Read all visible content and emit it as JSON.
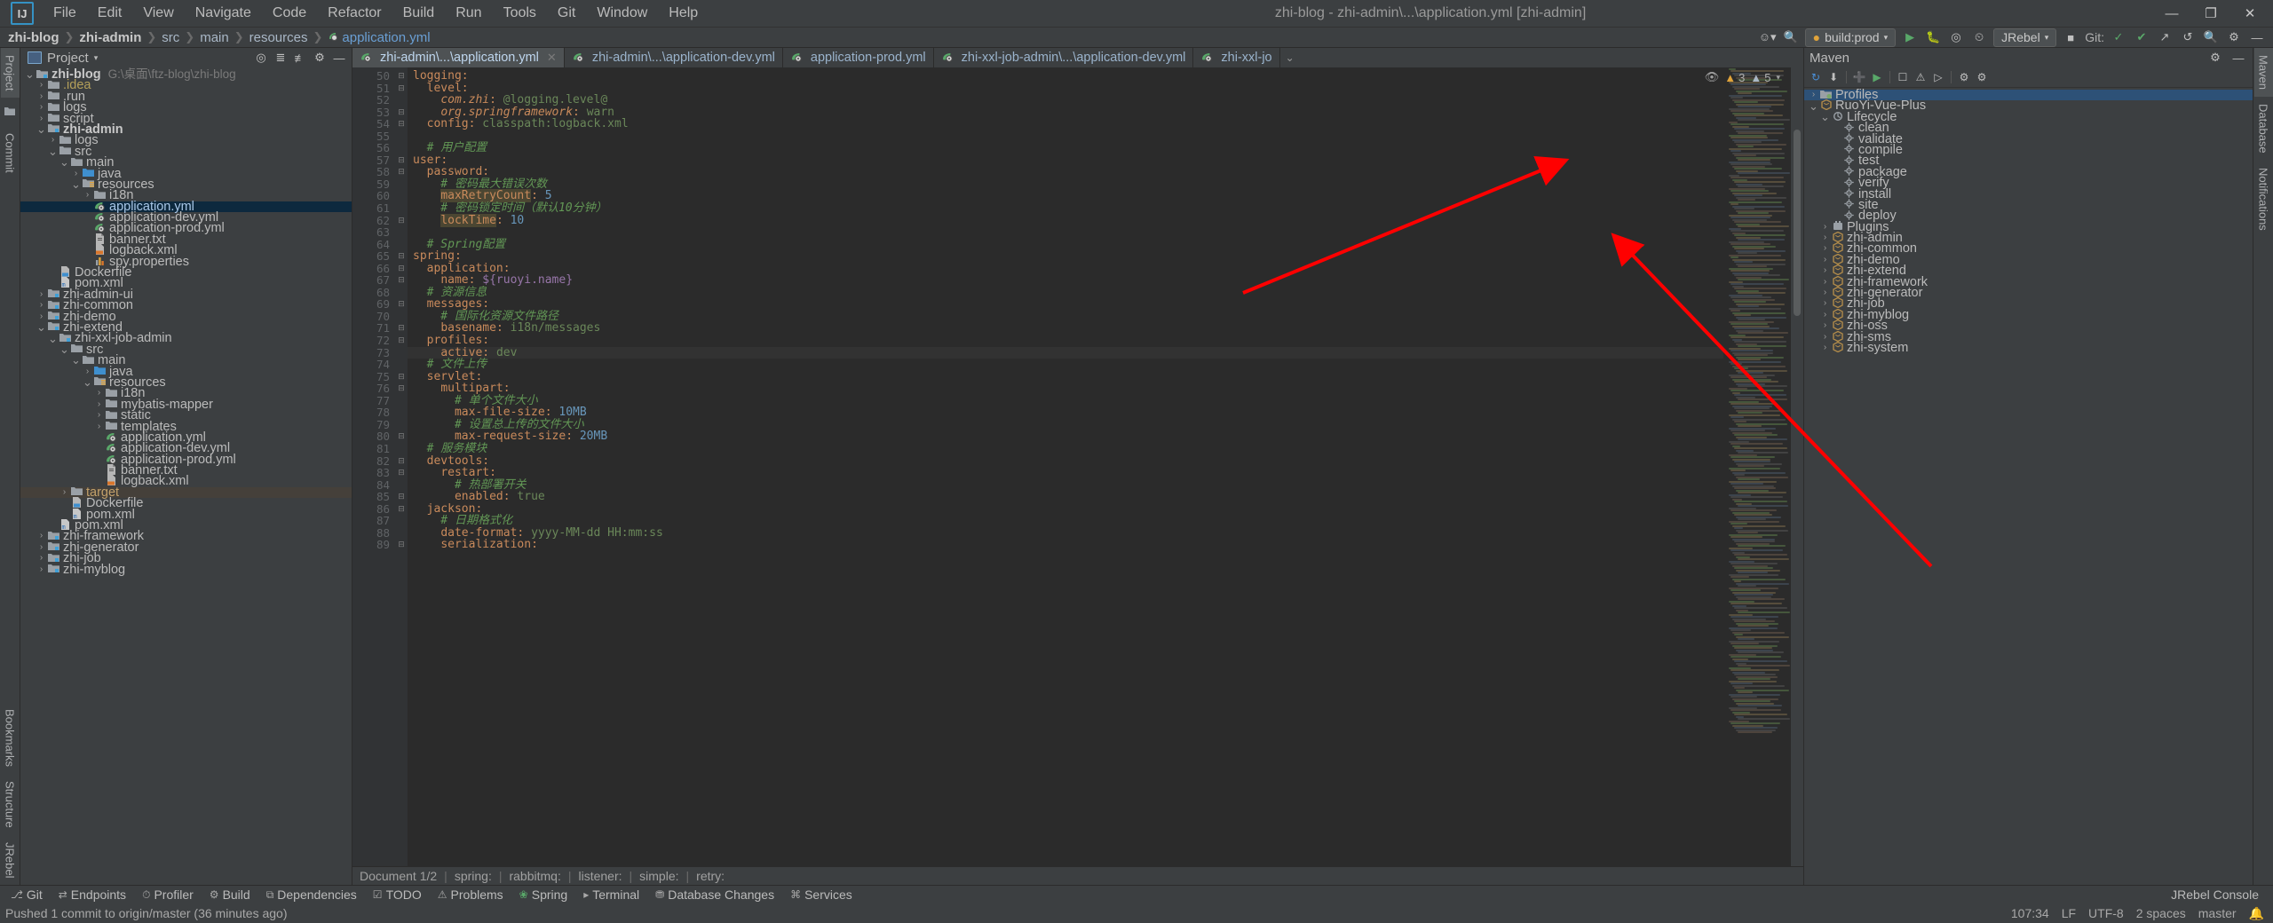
{
  "window": {
    "title": "zhi-blog - zhi-admin\\...\\application.yml [zhi-admin]",
    "logo": "IJ",
    "minimize": "—",
    "maximize": "❐",
    "close": "✕"
  },
  "menu": [
    "File",
    "Edit",
    "View",
    "Navigate",
    "Code",
    "Refactor",
    "Build",
    "Run",
    "Tools",
    "Git",
    "Window",
    "Help"
  ],
  "navbar": {
    "crumbs": [
      {
        "label": "zhi-blog",
        "bold": true
      },
      {
        "label": "zhi-admin",
        "bold": true
      },
      {
        "label": "src",
        "bold": false
      },
      {
        "label": "main",
        "bold": false
      },
      {
        "label": "resources",
        "bold": false
      },
      {
        "label": "application.yml",
        "bold": false,
        "icon": "yml-icon"
      }
    ],
    "run_config": "build:prod",
    "jrebel": "JRebel",
    "git_label": "Git:",
    "icons": [
      "user-icon",
      "search-everywhere-icon",
      "run-icon",
      "debug-icon",
      "coverage-icon",
      "profile-icon",
      "stop-icon",
      "settings-icon",
      "search-icon",
      "minimize-icon"
    ]
  },
  "left_stripe": [
    "Project",
    "Commit"
  ],
  "left_stripe_bottom": [
    "Bookmarks",
    "Structure",
    "JRebel"
  ],
  "right_stripe": [
    "Maven",
    "Database",
    "Notifications"
  ],
  "project_panel": {
    "title": "Project",
    "tree": [
      {
        "depth": 0,
        "arrow": "v",
        "icon": "module-icon",
        "label": "zhi-blog",
        "bold": true,
        "sub": "G:\\桌面\\ftz-blog\\zhi-blog"
      },
      {
        "depth": 1,
        "arrow": ">",
        "icon": "folder-icon",
        "label": ".idea",
        "yellow": true
      },
      {
        "depth": 1,
        "arrow": ">",
        "icon": "folder-icon",
        "label": ".run"
      },
      {
        "depth": 1,
        "arrow": ">",
        "icon": "folder-icon",
        "label": "logs"
      },
      {
        "depth": 1,
        "arrow": ">",
        "icon": "folder-icon",
        "label": "script"
      },
      {
        "depth": 1,
        "arrow": "v",
        "icon": "module-icon",
        "label": "zhi-admin",
        "bold": true
      },
      {
        "depth": 2,
        "arrow": ">",
        "icon": "folder-icon",
        "label": "logs"
      },
      {
        "depth": 2,
        "arrow": "v",
        "icon": "folder-icon",
        "label": "src"
      },
      {
        "depth": 3,
        "arrow": "v",
        "icon": "folder-icon",
        "label": "main"
      },
      {
        "depth": 4,
        "arrow": ">",
        "icon": "source-folder-icon",
        "label": "java"
      },
      {
        "depth": 4,
        "arrow": "v",
        "icon": "resource-folder-icon",
        "label": "resources"
      },
      {
        "depth": 5,
        "arrow": ">",
        "icon": "folder-icon",
        "label": "i18n"
      },
      {
        "depth": 5,
        "arrow": "",
        "icon": "yml-icon",
        "label": "application.yml",
        "selected": true
      },
      {
        "depth": 5,
        "arrow": "",
        "icon": "yml-icon",
        "label": "application-dev.yml"
      },
      {
        "depth": 5,
        "arrow": "",
        "icon": "yml-icon",
        "label": "application-prod.yml"
      },
      {
        "depth": 5,
        "arrow": "",
        "icon": "text-file-icon",
        "label": "banner.txt"
      },
      {
        "depth": 5,
        "arrow": "",
        "icon": "xml-file-icon",
        "label": "logback.xml"
      },
      {
        "depth": 5,
        "arrow": "",
        "icon": "properties-file-icon",
        "label": "spy.properties"
      },
      {
        "depth": 2,
        "arrow": "",
        "icon": "docker-icon",
        "label": "Dockerfile"
      },
      {
        "depth": 2,
        "arrow": "",
        "icon": "maven-icon",
        "label": "pom.xml"
      },
      {
        "depth": 1,
        "arrow": ">",
        "icon": "module-icon",
        "label": "zhi-admin-ui"
      },
      {
        "depth": 1,
        "arrow": ">",
        "icon": "module-icon",
        "label": "zhi-common"
      },
      {
        "depth": 1,
        "arrow": ">",
        "icon": "module-icon",
        "label": "zhi-demo"
      },
      {
        "depth": 1,
        "arrow": "v",
        "icon": "module-icon",
        "label": "zhi-extend"
      },
      {
        "depth": 2,
        "arrow": "v",
        "icon": "module-icon",
        "label": "zhi-xxl-job-admin"
      },
      {
        "depth": 3,
        "arrow": "v",
        "icon": "folder-icon",
        "label": "src"
      },
      {
        "depth": 4,
        "arrow": "v",
        "icon": "folder-icon",
        "label": "main"
      },
      {
        "depth": 5,
        "arrow": ">",
        "icon": "source-folder-icon",
        "label": "java"
      },
      {
        "depth": 5,
        "arrow": "v",
        "icon": "resource-folder-icon",
        "label": "resources"
      },
      {
        "depth": 6,
        "arrow": ">",
        "icon": "folder-icon",
        "label": "i18n"
      },
      {
        "depth": 6,
        "arrow": ">",
        "icon": "folder-icon",
        "label": "mybatis-mapper"
      },
      {
        "depth": 6,
        "arrow": ">",
        "icon": "folder-icon",
        "label": "static"
      },
      {
        "depth": 6,
        "arrow": ">",
        "icon": "folder-icon",
        "label": "templates"
      },
      {
        "depth": 6,
        "arrow": "",
        "icon": "yml-icon",
        "label": "application.yml"
      },
      {
        "depth": 6,
        "arrow": "",
        "icon": "yml-icon",
        "label": "application-dev.yml"
      },
      {
        "depth": 6,
        "arrow": "",
        "icon": "yml-icon",
        "label": "application-prod.yml"
      },
      {
        "depth": 6,
        "arrow": "",
        "icon": "text-file-icon",
        "label": "banner.txt"
      },
      {
        "depth": 6,
        "arrow": "",
        "icon": "xml-file-icon",
        "label": "logback.xml"
      },
      {
        "depth": 3,
        "arrow": ">",
        "icon": "folder-icon",
        "label": "target",
        "target": true
      },
      {
        "depth": 3,
        "arrow": "",
        "icon": "docker-icon",
        "label": "Dockerfile"
      },
      {
        "depth": 3,
        "arrow": "",
        "icon": "maven-icon",
        "label": "pom.xml"
      },
      {
        "depth": 2,
        "arrow": "",
        "icon": "maven-icon",
        "label": "pom.xml"
      },
      {
        "depth": 1,
        "arrow": ">",
        "icon": "module-icon",
        "label": "zhi-framework"
      },
      {
        "depth": 1,
        "arrow": ">",
        "icon": "module-icon",
        "label": "zhi-generator"
      },
      {
        "depth": 1,
        "arrow": ">",
        "icon": "module-icon",
        "label": "zhi-job"
      },
      {
        "depth": 1,
        "arrow": ">",
        "icon": "module-icon",
        "label": "zhi-myblog"
      }
    ]
  },
  "editor": {
    "tabs": [
      {
        "label": "zhi-admin\\...\\application.yml",
        "active": true,
        "closable": true
      },
      {
        "label": "zhi-admin\\...\\application-dev.yml",
        "active": false
      },
      {
        "label": "application-prod.yml",
        "active": false
      },
      {
        "label": "zhi-xxl-job-admin\\...\\application-dev.yml",
        "active": false
      },
      {
        "label": "zhi-xxl-jo",
        "active": false
      }
    ],
    "inspections": {
      "warnings": "3",
      "weak": "5",
      "status": "ok"
    },
    "first_line": 50,
    "lines": [
      {
        "n": 50,
        "fold": "v",
        "text": "logging:",
        "kind": "key"
      },
      {
        "n": 51,
        "fold": "v",
        "text": "  level:",
        "kind": "key"
      },
      {
        "n": 52,
        "fold": "",
        "text": "    com.zhi: @logging.level@",
        "kind": "italic-key"
      },
      {
        "n": 53,
        "fold": "^",
        "text": "    org.springframework: warn",
        "kind": "italic-key"
      },
      {
        "n": 54,
        "fold": "^",
        "text": "  config: classpath:logback.xml",
        "kind": "key"
      },
      {
        "n": 55,
        "fold": "",
        "text": "",
        "kind": "blank"
      },
      {
        "n": 56,
        "fold": "",
        "text": "  # 用户配置",
        "kind": "comment"
      },
      {
        "n": 57,
        "fold": "v",
        "text": "user:",
        "kind": "key"
      },
      {
        "n": 58,
        "fold": "v",
        "text": "  password:",
        "kind": "key"
      },
      {
        "n": 59,
        "fold": "",
        "text": "    # 密码最大错误次数",
        "kind": "comment"
      },
      {
        "n": 60,
        "fold": "",
        "text": "    maxRetryCount: 5",
        "kind": "hl-key"
      },
      {
        "n": 61,
        "fold": "",
        "text": "    # 密码锁定时间（默认10分钟）",
        "kind": "comment"
      },
      {
        "n": 62,
        "fold": "^",
        "text": "    lockTime: 10",
        "kind": "hl-key"
      },
      {
        "n": 63,
        "fold": "",
        "text": "",
        "kind": "blank"
      },
      {
        "n": 64,
        "fold": "",
        "text": "  # Spring配置",
        "kind": "comment"
      },
      {
        "n": 65,
        "fold": "v",
        "text": "spring:",
        "kind": "key"
      },
      {
        "n": 66,
        "fold": "v",
        "text": "  application:",
        "kind": "key"
      },
      {
        "n": 67,
        "fold": "^",
        "text": "    name: ${ruoyi.name}",
        "kind": "key-var"
      },
      {
        "n": 68,
        "fold": "",
        "text": "  # 资源信息",
        "kind": "comment"
      },
      {
        "n": 69,
        "fold": "v",
        "text": "  messages:",
        "kind": "key"
      },
      {
        "n": 70,
        "fold": "",
        "text": "    # 国际化资源文件路径",
        "kind": "comment"
      },
      {
        "n": 71,
        "fold": "^",
        "text": "    basename: i18n/messages",
        "kind": "key"
      },
      {
        "n": 72,
        "fold": "v",
        "text": "  profiles:",
        "kind": "key"
      },
      {
        "n": 73,
        "fold": "",
        "text": "    active: dev",
        "kind": "key",
        "current": true
      },
      {
        "n": 74,
        "fold": "",
        "text": "  # 文件上传",
        "kind": "comment"
      },
      {
        "n": 75,
        "fold": "v",
        "text": "  servlet:",
        "kind": "key"
      },
      {
        "n": 76,
        "fold": "v",
        "text": "    multipart:",
        "kind": "key"
      },
      {
        "n": 77,
        "fold": "",
        "text": "      # 单个文件大小",
        "kind": "comment"
      },
      {
        "n": 78,
        "fold": "",
        "text": "      max-file-size: 10MB",
        "kind": "key"
      },
      {
        "n": 79,
        "fold": "",
        "text": "      # 设置总上传的文件大小",
        "kind": "comment"
      },
      {
        "n": 80,
        "fold": "^",
        "text": "      max-request-size: 20MB",
        "kind": "key"
      },
      {
        "n": 81,
        "fold": "",
        "text": "  # 服务模块",
        "kind": "comment"
      },
      {
        "n": 82,
        "fold": "v",
        "text": "  devtools:",
        "kind": "key"
      },
      {
        "n": 83,
        "fold": "v",
        "text": "    restart:",
        "kind": "key"
      },
      {
        "n": 84,
        "fold": "",
        "text": "      # 热部署开关",
        "kind": "comment"
      },
      {
        "n": 85,
        "fold": "^",
        "text": "      enabled: true",
        "kind": "key"
      },
      {
        "n": 86,
        "fold": "v",
        "text": "  jackson:",
        "kind": "key"
      },
      {
        "n": 87,
        "fold": "",
        "text": "    # 日期格式化",
        "kind": "comment"
      },
      {
        "n": 88,
        "fold": "",
        "text": "    date-format: yyyy-MM-dd HH:mm:ss",
        "kind": "key"
      },
      {
        "n": 89,
        "fold": "v",
        "text": "    serialization:",
        "kind": "key"
      }
    ],
    "breadcrumb": [
      "Document 1/2",
      "spring:",
      "rabbitmq:",
      "listener:",
      "simple:",
      "retry:"
    ]
  },
  "maven": {
    "title": "Maven",
    "toolbar_icons": [
      "refresh-icon",
      "add-icon",
      "download-sources-icon",
      "run-icon",
      "toggle-offline-icon",
      "skip-tests-icon",
      "execute-goal-icon",
      "profiles-icon",
      "settings-icon",
      "help-icon"
    ],
    "tree": [
      {
        "depth": 0,
        "arrow": ">",
        "icon": "profiles-icon",
        "label": "Profiles",
        "selected": true
      },
      {
        "depth": 0,
        "arrow": "v",
        "icon": "maven-project-icon",
        "label": "RuoYi-Vue-Plus"
      },
      {
        "depth": 1,
        "arrow": "v",
        "icon": "lifecycle-icon",
        "label": "Lifecycle"
      },
      {
        "depth": 2,
        "arrow": "",
        "icon": "goal-icon",
        "label": "clean"
      },
      {
        "depth": 2,
        "arrow": "",
        "icon": "goal-icon",
        "label": "validate"
      },
      {
        "depth": 2,
        "arrow": "",
        "icon": "goal-icon",
        "label": "compile"
      },
      {
        "depth": 2,
        "arrow": "",
        "icon": "goal-icon",
        "label": "test"
      },
      {
        "depth": 2,
        "arrow": "",
        "icon": "goal-icon",
        "label": "package"
      },
      {
        "depth": 2,
        "arrow": "",
        "icon": "goal-icon",
        "label": "verify"
      },
      {
        "depth": 2,
        "arrow": "",
        "icon": "goal-icon",
        "label": "install"
      },
      {
        "depth": 2,
        "arrow": "",
        "icon": "goal-icon",
        "label": "site"
      },
      {
        "depth": 2,
        "arrow": "",
        "icon": "goal-icon",
        "label": "deploy"
      },
      {
        "depth": 1,
        "arrow": ">",
        "icon": "plugins-icon",
        "label": "Plugins"
      },
      {
        "depth": 1,
        "arrow": ">",
        "icon": "maven-project-icon",
        "label": "zhi-admin"
      },
      {
        "depth": 1,
        "arrow": ">",
        "icon": "maven-project-icon",
        "label": "zhi-common"
      },
      {
        "depth": 1,
        "arrow": ">",
        "icon": "maven-project-icon",
        "label": "zhi-demo"
      },
      {
        "depth": 1,
        "arrow": ">",
        "icon": "maven-project-icon",
        "label": "zhi-extend"
      },
      {
        "depth": 1,
        "arrow": ">",
        "icon": "maven-project-icon",
        "label": "zhi-framework"
      },
      {
        "depth": 1,
        "arrow": ">",
        "icon": "maven-project-icon",
        "label": "zhi-generator"
      },
      {
        "depth": 1,
        "arrow": ">",
        "icon": "maven-project-icon",
        "label": "zhi-job"
      },
      {
        "depth": 1,
        "arrow": ">",
        "icon": "maven-project-icon",
        "label": "zhi-myblog"
      },
      {
        "depth": 1,
        "arrow": ">",
        "icon": "maven-project-icon",
        "label": "zhi-oss"
      },
      {
        "depth": 1,
        "arrow": ">",
        "icon": "maven-project-icon",
        "label": "zhi-sms"
      },
      {
        "depth": 1,
        "arrow": ">",
        "icon": "maven-project-icon",
        "label": "zhi-system"
      }
    ]
  },
  "tool_windows": [
    {
      "label": "Git",
      "icon": "git-icon"
    },
    {
      "label": "Endpoints",
      "icon": "endpoints-icon"
    },
    {
      "label": "Profiler",
      "icon": "profiler-icon"
    },
    {
      "label": "Build",
      "icon": "build-icon"
    },
    {
      "label": "Dependencies",
      "icon": "dependencies-icon"
    },
    {
      "label": "TODO",
      "icon": "todo-icon"
    },
    {
      "label": "Problems",
      "icon": "problems-icon"
    },
    {
      "label": "Spring",
      "icon": "spring-icon"
    },
    {
      "label": "Terminal",
      "icon": "terminal-icon"
    },
    {
      "label": "Database Changes",
      "icon": "database-icon"
    },
    {
      "label": "Services",
      "icon": "services-icon"
    }
  ],
  "tool_windows_right": [
    "JRebel Console"
  ],
  "statusbar": {
    "message": "Pushed 1 commit to origin/master (36 minutes ago)",
    "caret": "107:34",
    "line_sep": "LF",
    "encoding": "UTF-8",
    "indent": "2 spaces",
    "branch": "master"
  },
  "annotations": {
    "arrow_color": "#ff0000"
  }
}
